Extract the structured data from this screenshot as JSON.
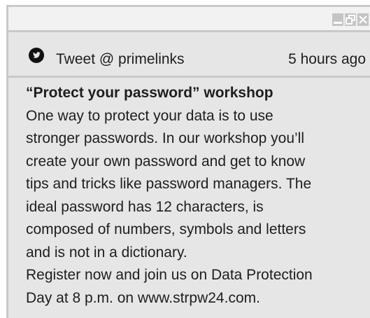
{
  "window": {
    "controls": [
      "minimize-icon",
      "restore-icon",
      "close-icon"
    ]
  },
  "tweet": {
    "icon": "twitter-icon",
    "handle": "Tweet @ primelinks",
    "time": "5 hours ago",
    "title": "“Protect your password” workshop",
    "lines": [
      "One way to protect your data is to use",
      "stronger passwords. In our workshop you’ll",
      "create your own password and get to know",
      "tips and tricks like password managers. The",
      "ideal password has 12 characters, is",
      "composed of numbers, symbols and letters",
      "and is not in a dictionary.",
      "Register now and join us on Data Protection",
      "Day at 8 p.m. on www.strpw24.com."
    ]
  },
  "colors": {
    "background": "#e6e6e6",
    "titlebar": "#f2f2f2",
    "border": "#c9c9c9",
    "text": "#1e1e1e"
  }
}
